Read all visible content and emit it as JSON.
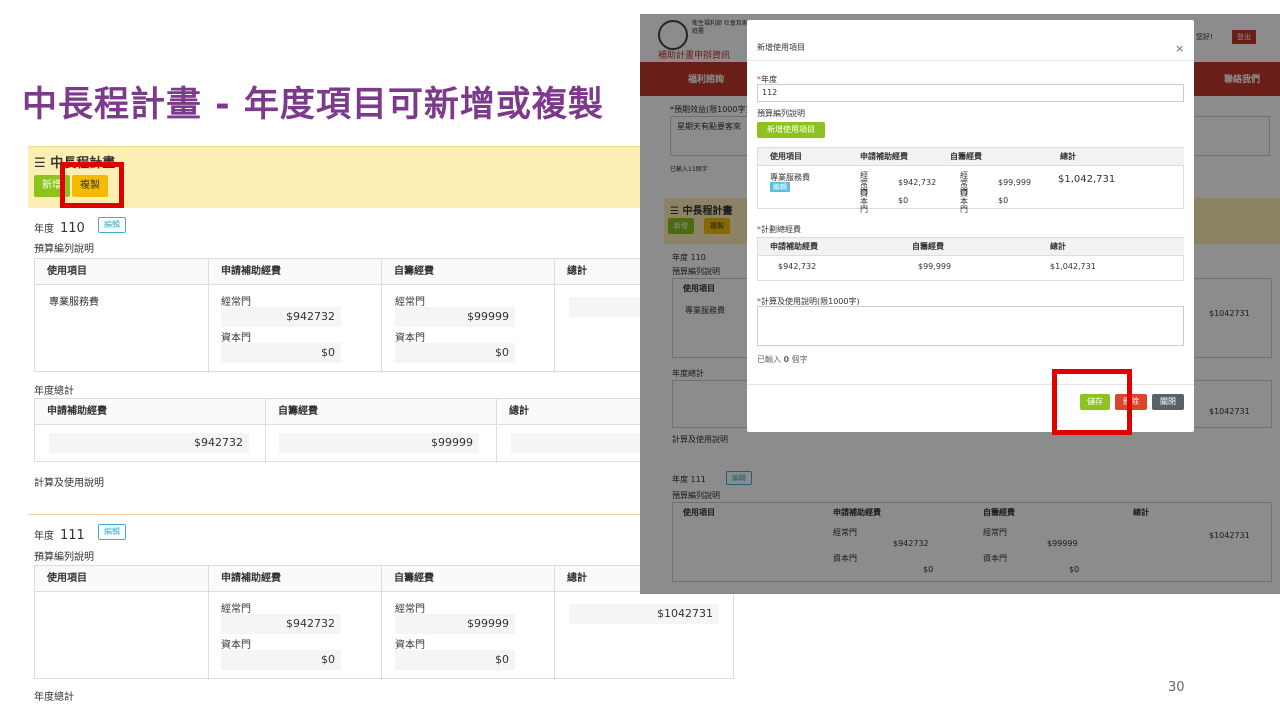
{
  "slide": {
    "title": "中長程計畫 - 年度項目可新增或複製",
    "page_number": "30"
  },
  "left_panel": {
    "header_title": "中長程計畫",
    "add_button": "新增",
    "copy_button": "複製",
    "year_label": "年度",
    "edit_button": "編輯",
    "budget_desc_label": "預算編列說明",
    "columns": [
      "使用項目",
      "申請補助經費",
      "自籌經費",
      "總計"
    ],
    "regular_label": "經常門",
    "capital_label": "資本門",
    "year_total_label": "年度總計",
    "total_columns": [
      "申請補助經費",
      "自籌經費",
      "總計"
    ],
    "calc_label": "計算及使用說明",
    "years": [
      {
        "year": "110",
        "item": "專業服務費",
        "subsidy_regular": "$942732",
        "subsidy_capital": "$0",
        "self_regular": "$99999",
        "self_capital": "$0",
        "total": "",
        "year_subsidy": "$942732",
        "year_self": "$99999"
      },
      {
        "year": "111",
        "item": "",
        "subsidy_regular": "$942732",
        "subsidy_capital": "$0",
        "self_regular": "$99999",
        "self_capital": "$0",
        "total": "$1042731"
      }
    ]
  },
  "right_screen": {
    "logo_text": "衛生福利部 社會及家庭署",
    "logo_sub": "補助計畫申辦資訊",
    "hello": "您好!",
    "logout": "登出",
    "nav": {
      "welfare": "福利諮詢",
      "contact": "聯絡我們"
    },
    "bg_expected_benefit": "*預期效益(限1000字)",
    "bg_benefit_text": "星期天有點要客來",
    "bg_char_count": "已輸入11個字",
    "bg_header": "中長程計畫",
    "bg_add": "新增",
    "bg_copy": "複製",
    "bg_year_110": "110",
    "bg_year_111": "111",
    "bg_edit": "編輯",
    "bg_year": "年度",
    "bg_budget": "預算編列說明",
    "bg_cols": [
      "使用項目",
      "申請補助經費",
      "自籌經費",
      "總計"
    ],
    "bg_item": "專業服務費",
    "bg_total": "$1042731",
    "bg_year_total": "年度總計",
    "bg_calc": "計算及使用說明",
    "bg_regular": "經常門",
    "bg_capital": "資本門",
    "bg_subsidy": "$942732",
    "bg_self": "$99999",
    "bg_zero": "$0"
  },
  "modal": {
    "title": "新增使用項目",
    "close": "×",
    "year_label": "年度",
    "year_value": "112",
    "budget_label": "預算編列說明",
    "add_item_button": "新增使用項目",
    "columns": [
      "使用項目",
      "申請補助經費",
      "自籌經費",
      "總計"
    ],
    "row": {
      "item": "專業服務費",
      "edit": "編輯",
      "regular": "經常門",
      "capital": "資本門",
      "subsidy_regular": "$942,732",
      "subsidy_capital": "$0",
      "self_regular": "$99,999",
      "self_capital": "$0",
      "total": "$1,042,731"
    },
    "plan_total_label": "計劃總經費",
    "total_columns": [
      "申請補助經費",
      "自籌經費",
      "總計"
    ],
    "total_values": [
      "$942,732",
      "$99,999",
      "$1,042,731"
    ],
    "calc_label": "計算及使用說明(限1000字)",
    "char_prefix": "已輸入",
    "char_count": "0",
    "char_suffix": "個字",
    "save_button": "儲存",
    "delete_button": "刪除",
    "close_button": "關閉"
  },
  "colors": {
    "title": "#7d3a8c",
    "highlight": "#e00000",
    "green": "#8dc21f",
    "yellow": "#f4bc00",
    "red_nav": "#c0392b"
  }
}
